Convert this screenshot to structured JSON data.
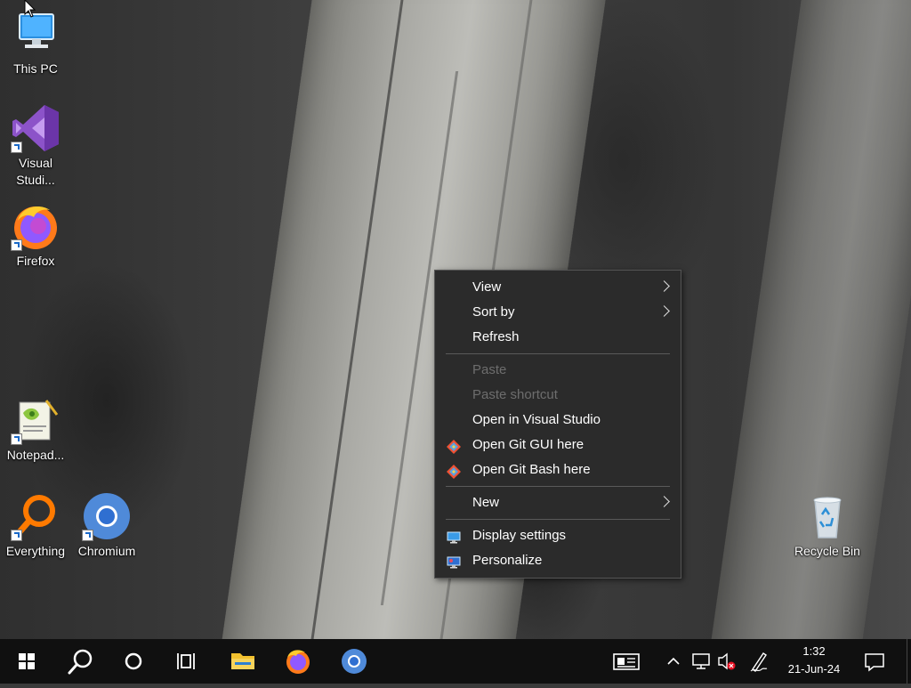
{
  "desktop_icons": {
    "this_pc": "This PC",
    "visual_studio": "Visual Studi...",
    "firefox": "Firefox",
    "notepad": "Notepad...",
    "everything": "Everything",
    "chromium": "Chromium",
    "recycle_bin": "Recycle Bin"
  },
  "context_menu": {
    "view": "View",
    "sort_by": "Sort by",
    "refresh": "Refresh",
    "paste": "Paste",
    "paste_shortcut": "Paste shortcut",
    "open_in_visual_studio": "Open in Visual Studio",
    "open_git_gui": "Open Git GUI here",
    "open_git_bash": "Open Git Bash here",
    "new": "New",
    "display_settings": "Display settings",
    "personalize": "Personalize"
  },
  "taskbar": {
    "time": "1:32",
    "date": "21-Jun-24"
  },
  "colors": {
    "menu_bg": "#2b2b2b",
    "taskbar_bg": "#101010",
    "disabled_text": "#6d6d6d"
  }
}
